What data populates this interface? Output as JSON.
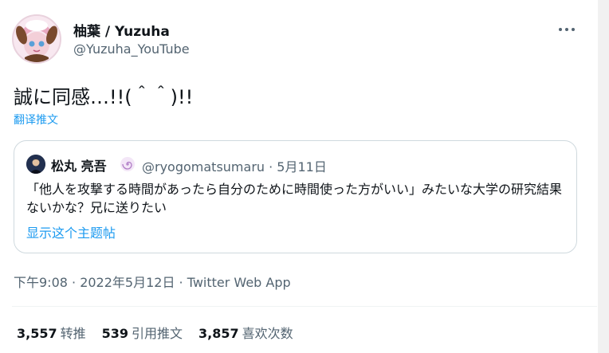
{
  "author": {
    "name": "柚葉 / Yuzuha",
    "handle": "@Yuzuha_YouTube"
  },
  "tweet": {
    "text": "誠に同感…!!(＾＾)!!",
    "translate_label": "翻译推文"
  },
  "quote": {
    "name": "松丸 亮吾",
    "handle_date": "@ryogomatsumaru · 5月11日",
    "text": "「他人を攻撃する時間があったら自分のために時間使った方がいい」みたいな大学の研究結果ないかな？兄に送りたい",
    "thread_label": "显示这个主题帖"
  },
  "meta": {
    "timestamp": "下午9:08 · 2022年5月12日 · ",
    "source": "Twitter Web App"
  },
  "stats": {
    "retweets": {
      "count": "3,557",
      "label": "转推"
    },
    "quotes": {
      "count": "539",
      "label": "引用推文"
    },
    "likes": {
      "count": "3,857",
      "label": "喜欢次数"
    }
  },
  "colors": {
    "link": "#1d9bf0",
    "secondary_text": "#536471",
    "border": "#cfd9de"
  }
}
